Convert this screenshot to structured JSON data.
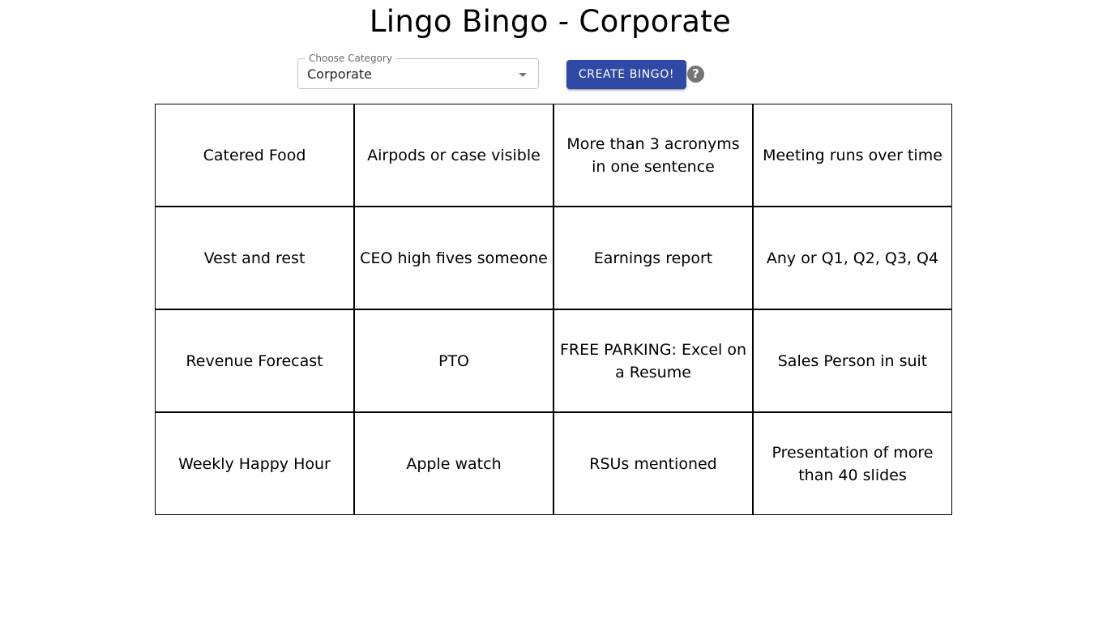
{
  "header": {
    "title": "Lingo Bingo - Corporate"
  },
  "controls": {
    "category_label": "Choose Category",
    "category_value": "Corporate",
    "create_button_label": "CREATE BINGO!",
    "help_icon_glyph": "?",
    "accent_color": "#3049a5"
  },
  "board": {
    "cells": [
      "Catered Food",
      "Airpods or case visible",
      "More than 3 acronyms in one sentence",
      "Meeting runs over time",
      "Vest and rest",
      "CEO high fives someone",
      "Earnings report",
      "Any or Q1, Q2, Q3, Q4",
      "Revenue Forecast",
      "PTO",
      "FREE PARKING: Excel on a Resume",
      "Sales Person in suit",
      "Weekly Happy Hour",
      "Apple watch",
      "RSUs mentioned",
      "Presentation of more than 40 slides"
    ]
  }
}
